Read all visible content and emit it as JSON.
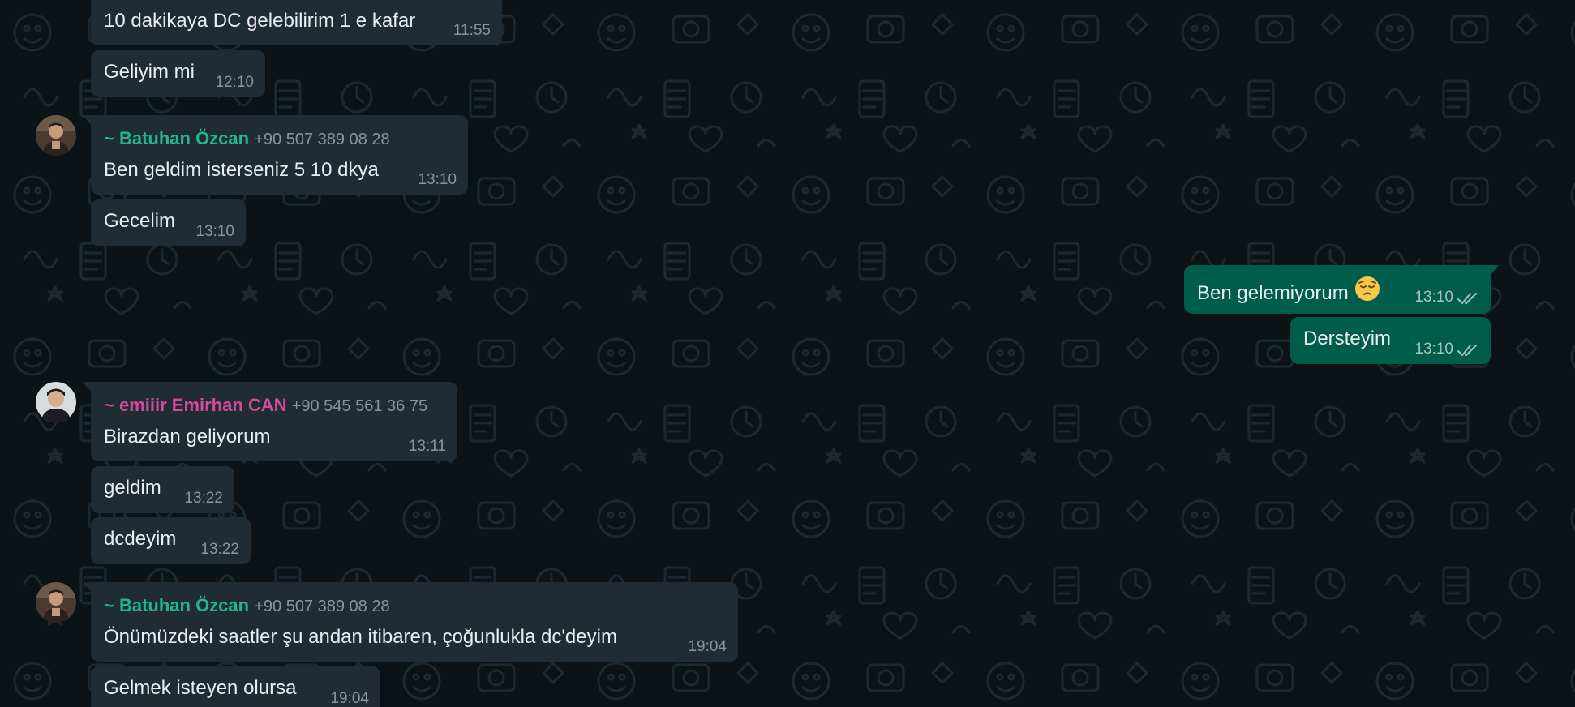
{
  "colors": {
    "background": "#0c1317",
    "incoming_bubble": "#202c33",
    "outgoing_bubble": "#005c4b",
    "text": "#e9edef",
    "meta": "#8696a0",
    "sender_batuhan": "#25b48e",
    "sender_emirhan": "#d4499a",
    "read_ticks": "#a3c6bc"
  },
  "messages": [
    {
      "text": "10 dakikaya DC gelebilirim 1 e kafar",
      "time": "11:55"
    },
    {
      "text": "Geliyim mi",
      "time": "12:10"
    },
    {
      "sender": "~ Batuhan Özcan",
      "phone": "+90 507 389 08 28",
      "text": "Ben geldim isterseniz 5 10 dkya",
      "time": "13:10"
    },
    {
      "text": "Gecelim",
      "time": "13:10"
    },
    {
      "text": "Ben gelemiyorum",
      "emoji": "pensive-face",
      "time": "13:10",
      "status": "read"
    },
    {
      "text": "Dersteyim",
      "time": "13:10",
      "status": "read"
    },
    {
      "sender": "~ emiiir Emirhan CAN",
      "phone": "+90 545 561 36 75",
      "text": "Birazdan geliyorum",
      "time": "13:11"
    },
    {
      "text": "geldim",
      "time": "13:22"
    },
    {
      "text": "dcdeyim",
      "time": "13:22"
    },
    {
      "sender": "~ Batuhan Özcan",
      "phone": "+90 507 389 08 28",
      "text": "Önümüzdeki saatler şu andan itibaren, çoğunlukla dc'deyim",
      "time": "19:04"
    },
    {
      "text": "Gelmek isteyen olursa",
      "time": "19:04"
    }
  ]
}
